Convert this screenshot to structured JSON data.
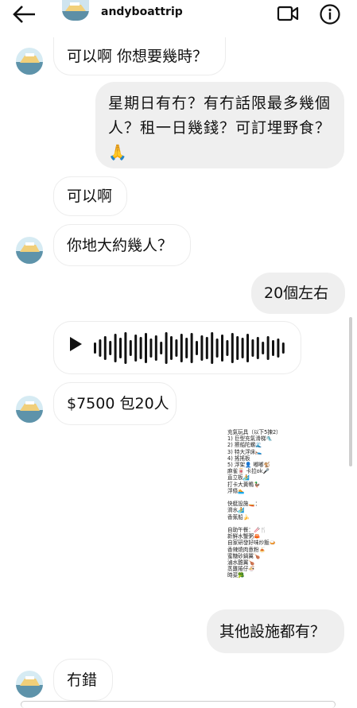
{
  "header": {
    "username": "andyboattrip",
    "icons": [
      "back-arrow-icon",
      "video-call-icon",
      "info-icon"
    ]
  },
  "messages": [
    {
      "id": "m1",
      "from": "them",
      "text": "可以啊 你想要幾時？"
    },
    {
      "id": "m2",
      "from": "me",
      "lines": [
        "星期日有冇？有冇話限最多幾個",
        "人？租一日幾錢？可訂埋野食？",
        "🙏"
      ]
    },
    {
      "id": "m3",
      "from": "them",
      "text": "可以啊"
    },
    {
      "id": "m4",
      "from": "them",
      "text": "你地大約幾人？"
    },
    {
      "id": "m5",
      "from": "me",
      "text": "20個左右"
    },
    {
      "id": "m6",
      "from": "them",
      "type": "voice-message"
    },
    {
      "id": "m7",
      "from": "them",
      "text": "$7500 包20人"
    },
    {
      "id": "m8",
      "from": "them",
      "type": "image",
      "lines": [
        "充氣玩具（以下5揀2）",
        "1) 巨型充氣滑梯🛝",
        "2) 擦船陀螺🌊",
        "3) 特大浮床🛌",
        "4) 搖搖板",
        "5) 浮架👤 嘟嘟🐒",
        "  麻雀🀄 卡拉ok🎤",
        "  直立板🏄",
        "  打卡大黃鴨🦆",
        "  浮條🏊",
        "",
        "快艇設施🚤：",
        "滑水🏄",
        "香蕉船🍌",
        "",
        "自助午餐：🥢🍴",
        "新鮮水蟹粥🦀",
        "自家研發好味炒飯🍛",
        "香辣燒肉意粉🍝",
        "蜜糖砂鍋翼🍗",
        "滷水雞翼🍗",
        "蒸雞捲仔🍜",
        "時菜🥦"
      ]
    },
    {
      "id": "m9",
      "from": "me",
      "text": "其他設施都有？"
    },
    {
      "id": "m10",
      "from": "them",
      "text": "冇錯"
    }
  ]
}
